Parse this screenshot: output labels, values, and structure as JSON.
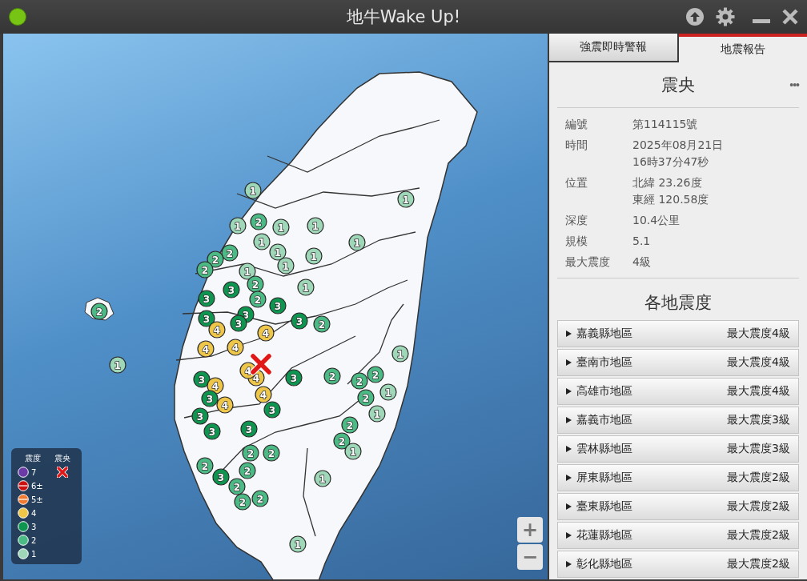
{
  "window": {
    "title": "地牛Wake Up!"
  },
  "tabs": [
    {
      "label": "強震即時警報",
      "selected": false
    },
    {
      "label": "地震報告",
      "selected": true
    }
  ],
  "report": {
    "title": "震央",
    "more": "•••",
    "fields": [
      {
        "label": "編號",
        "lines": [
          "第114115號"
        ]
      },
      {
        "label": "時間",
        "lines": [
          "2025年08月21日",
          "16時37分47秒"
        ]
      },
      {
        "label": "位置",
        "lines": [
          "北緯 23.26度",
          "東經 120.58度"
        ]
      },
      {
        "label": "深度",
        "lines": [
          "10.4公里"
        ]
      },
      {
        "label": "規模",
        "lines": [
          "5.1"
        ]
      },
      {
        "label": "最大震度",
        "lines": [
          "4級"
        ]
      }
    ],
    "regions_title": "各地震度",
    "regions": [
      {
        "name": "嘉義縣地區",
        "max": "最大震度4級"
      },
      {
        "name": "臺南市地區",
        "max": "最大震度4級"
      },
      {
        "name": "高雄市地區",
        "max": "最大震度4級"
      },
      {
        "name": "嘉義市地區",
        "max": "最大震度3級"
      },
      {
        "name": "雲林縣地區",
        "max": "最大震度3級"
      },
      {
        "name": "屏東縣地區",
        "max": "最大震度2級"
      },
      {
        "name": "臺東縣地區",
        "max": "最大震度2級"
      },
      {
        "name": "花蓮縣地區",
        "max": "最大震度2級"
      },
      {
        "name": "彰化縣地區",
        "max": "最大震度2級"
      }
    ]
  },
  "map": {
    "markers": [
      {
        "intensity": "1",
        "color": "#9ed8b8"
      },
      {
        "intensity": "1",
        "color": "#9ed8b8"
      },
      {
        "intensity": "1",
        "color": "#9ed8b8"
      },
      {
        "intensity": "2",
        "color": "#4cba85"
      },
      {
        "intensity": "1",
        "color": "#9ed8b8"
      },
      {
        "intensity": "1",
        "color": "#9ed8b8"
      },
      {
        "intensity": "1",
        "color": "#9ed8b8"
      },
      {
        "intensity": "2",
        "color": "#4cba85"
      },
      {
        "intensity": "1",
        "color": "#9ed8b8"
      },
      {
        "intensity": "1",
        "color": "#9ed8b8"
      },
      {
        "intensity": "2",
        "color": "#4cba85"
      },
      {
        "intensity": "1",
        "color": "#9ed8b8"
      },
      {
        "intensity": "1",
        "color": "#9ed8b8"
      },
      {
        "intensity": "2",
        "color": "#4cba85"
      },
      {
        "intensity": "1",
        "color": "#9ed8b8"
      },
      {
        "intensity": "2",
        "color": "#4cba85"
      },
      {
        "intensity": "3",
        "color": "#0e9650"
      },
      {
        "intensity": "1",
        "color": "#9ed8b8"
      },
      {
        "intensity": "2",
        "color": "#4cba85"
      },
      {
        "intensity": "3",
        "color": "#0e9650"
      },
      {
        "intensity": "3",
        "color": "#0e9650"
      },
      {
        "intensity": "3",
        "color": "#0e9650"
      },
      {
        "intensity": "3",
        "color": "#0e9650"
      },
      {
        "intensity": "3",
        "color": "#0e9650"
      },
      {
        "intensity": "3",
        "color": "#0e9650"
      },
      {
        "intensity": "2",
        "color": "#4cba85"
      },
      {
        "intensity": "4",
        "color": "#eec64a"
      },
      {
        "intensity": "4",
        "color": "#eec64a"
      },
      {
        "intensity": "4",
        "color": "#eec64a"
      },
      {
        "intensity": "4",
        "color": "#eec64a"
      },
      {
        "intensity": "1",
        "color": "#9ed8b8"
      },
      {
        "intensity": "4",
        "color": "#eec64a"
      },
      {
        "intensity": "4",
        "color": "#eec64a"
      },
      {
        "intensity": "3",
        "color": "#0e9650"
      },
      {
        "intensity": "2",
        "color": "#4cba85"
      },
      {
        "intensity": "2",
        "color": "#4cba85"
      },
      {
        "intensity": "2",
        "color": "#4cba85"
      },
      {
        "intensity": "2",
        "color": "#4cba85"
      },
      {
        "intensity": "1",
        "color": "#9ed8b8"
      },
      {
        "intensity": "3",
        "color": "#0e9650"
      },
      {
        "intensity": "4",
        "color": "#eec64a"
      },
      {
        "intensity": "3",
        "color": "#0e9650"
      },
      {
        "intensity": "3",
        "color": "#0e9650"
      },
      {
        "intensity": "4",
        "color": "#eec64a"
      },
      {
        "intensity": "4",
        "color": "#eec64a"
      },
      {
        "intensity": "3",
        "color": "#0e9650"
      },
      {
        "intensity": "1",
        "color": "#9ed8b8"
      },
      {
        "intensity": "2",
        "color": "#4cba85"
      },
      {
        "intensity": "3",
        "color": "#0e9650"
      },
      {
        "intensity": "3",
        "color": "#0e9650"
      },
      {
        "intensity": "2",
        "color": "#4cba85"
      },
      {
        "intensity": "1",
        "color": "#9ed8b8"
      },
      {
        "intensity": "2",
        "color": "#4cba85"
      },
      {
        "intensity": "2",
        "color": "#4cba85"
      },
      {
        "intensity": "2",
        "color": "#4cba85"
      },
      {
        "intensity": "2",
        "color": "#4cba85"
      },
      {
        "intensity": "3",
        "color": "#0e9650"
      },
      {
        "intensity": "2",
        "color": "#4cba85"
      },
      {
        "intensity": "1",
        "color": "#9ed8b8"
      },
      {
        "intensity": "2",
        "color": "#4cba85"
      },
      {
        "intensity": "2",
        "color": "#4cba85"
      },
      {
        "intensity": "1",
        "color": "#9ed8b8"
      },
      {
        "intensity": "2",
        "color": "#4cba85"
      },
      {
        "intensity": "1",
        "color": "#9ed8b8"
      }
    ],
    "zoom_in": "+",
    "zoom_out": "−",
    "legend": {
      "intensity_heading": "震度",
      "epicenter_heading": "震央",
      "levels": [
        {
          "label": "7",
          "color": "#6b3aa6",
          "kind": "solid"
        },
        {
          "label": "6±",
          "color": "#cc1010",
          "kind": "split"
        },
        {
          "label": "5±",
          "color": "#f07a32",
          "kind": "split"
        },
        {
          "label": "4",
          "color": "#eec64a",
          "kind": "solid"
        },
        {
          "label": "3",
          "color": "#0e9650",
          "kind": "solid"
        },
        {
          "label": "2",
          "color": "#4cba85",
          "kind": "solid"
        },
        {
          "label": "1",
          "color": "#9ed8b8",
          "kind": "solid"
        }
      ]
    }
  }
}
